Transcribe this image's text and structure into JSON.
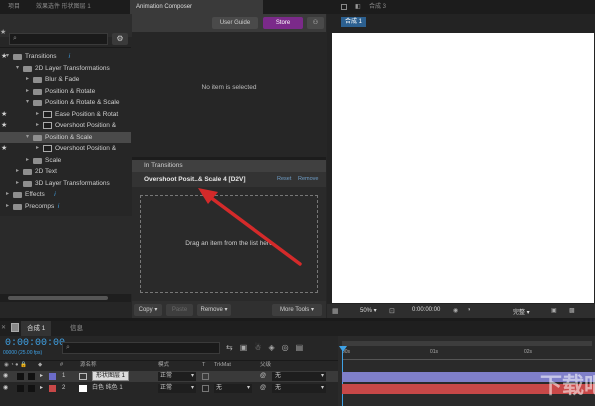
{
  "tabs": {
    "left": [
      "项目",
      "效果选件 形状图层 1"
    ],
    "active": "Animation Composer",
    "right": "合成 3"
  },
  "header_buttons": {
    "user_guide": "User Guide",
    "store": "Store"
  },
  "search_placeholder": "",
  "tree": [
    {
      "label": "Transitions",
      "level": 0,
      "kind": "root",
      "star": true,
      "info": "i"
    },
    {
      "label": "2D Layer Transformations",
      "level": 1,
      "kind": "folder"
    },
    {
      "label": "Blur & Fade",
      "level": 2,
      "kind": "folder"
    },
    {
      "label": "Position & Rotate",
      "level": 2,
      "kind": "folder"
    },
    {
      "label": "Position & Rotate & Scale",
      "level": 2,
      "kind": "folder",
      "open": true
    },
    {
      "label": "Ease Position & Rotat",
      "level": 3,
      "kind": "item",
      "star": true
    },
    {
      "label": "Overshoot Position &",
      "level": 3,
      "kind": "item",
      "star": true
    },
    {
      "label": "Position & Scale",
      "level": 2,
      "kind": "folder",
      "open": true,
      "highlight": true
    },
    {
      "label": "Overshoot Position &",
      "level": 3,
      "kind": "item",
      "star": true
    },
    {
      "label": "Scale",
      "level": 2,
      "kind": "folder"
    },
    {
      "label": "2D Text",
      "level": 1,
      "kind": "folder"
    },
    {
      "label": "3D Layer Transformations",
      "level": 1,
      "kind": "folder"
    },
    {
      "label": "Effects",
      "level": 0,
      "kind": "root",
      "info": "i"
    },
    {
      "label": "Precomps",
      "level": 0,
      "kind": "root",
      "info": "i"
    }
  ],
  "preview": {
    "no_item": "No item is selected"
  },
  "in_transitions": {
    "header": "In Transitions",
    "item": "Overshoot Posit..& Scale 4 [D2V]",
    "reset": "Reset",
    "remove": "Remove",
    "dropzone": "Drag an item from the list here"
  },
  "bottom_buttons": {
    "copy": "Copy",
    "paste": "Paste",
    "remove": "Remove",
    "more_tools": "More Tools"
  },
  "comp_viewer": {
    "comp_tab": "合成 1",
    "zoom": "50%",
    "timecode": "0:00:00:00",
    "quality": "完整"
  },
  "timeline": {
    "tab1": "合成 1",
    "tab2": "信息",
    "timecode": "0:00:00:00",
    "fps": "00000 (25.00 fps)",
    "columns": {
      "num": "#",
      "name": "源名称",
      "mode": "模式",
      "t": "T",
      "trkmat": "TrkMat",
      "parent": "父级"
    },
    "ruler": [
      "00s",
      "01s",
      "02s"
    ],
    "layers": [
      {
        "num": "1",
        "name": "形状图层 1",
        "mode": "正常",
        "trkmat": "",
        "parent": "无",
        "color": "#6c6cc8"
      },
      {
        "num": "2",
        "name": "白色 纯色 1",
        "mode": "正常",
        "trkmat": "无",
        "parent": "无",
        "color": "#c84848"
      }
    ]
  },
  "watermark": "下载吧"
}
